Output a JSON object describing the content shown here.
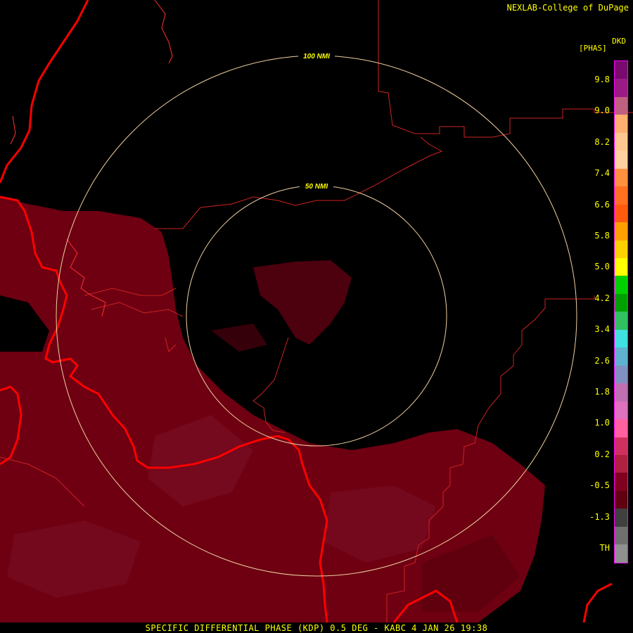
{
  "credit": "NEXLAB-College of DuPage",
  "product": {
    "code": "DKD",
    "units": "[PHAS]",
    "footer": "SPECIFIC DIFFERENTIAL PHASE (KDP) 0.5 DEG - KABC 4 JAN 26 19:38"
  },
  "rings": [
    {
      "label": "100 NMI",
      "range_nmi": 100
    },
    {
      "label": "50 NMI",
      "range_nmi": 50
    }
  ],
  "legend": {
    "labels": [
      "9.8",
      "9.0",
      "8.2",
      "7.4",
      "6.6",
      "5.8",
      "5.0",
      "4.2",
      "3.4",
      "2.6",
      "1.8",
      "1.0",
      "0.2",
      "-0.5",
      "-1.3",
      "TH"
    ],
    "colors": [
      "#7a0a6e",
      "#9a1a86",
      "#c06080",
      "#ffb070",
      "#ffc890",
      "#ffd0a0",
      "#ff9040",
      "#ff7020",
      "#ff5a10",
      "#ffa000",
      "#ffd000",
      "#ffff00",
      "#00d000",
      "#00a000",
      "#30c060",
      "#40e0e0",
      "#60b0d0",
      "#8090c0",
      "#c070b0",
      "#e070c0",
      "#ff60a0",
      "#d03060",
      "#b02040",
      "#800020",
      "#600010",
      "#404040",
      "#707070",
      "#909090"
    ]
  },
  "map": {
    "border_color": "#ff0000",
    "county_color": "#cc2222",
    "ring_color": "#f0d0a0",
    "echo_color": "#6e0012",
    "echo_light": "#7a0f25"
  }
}
